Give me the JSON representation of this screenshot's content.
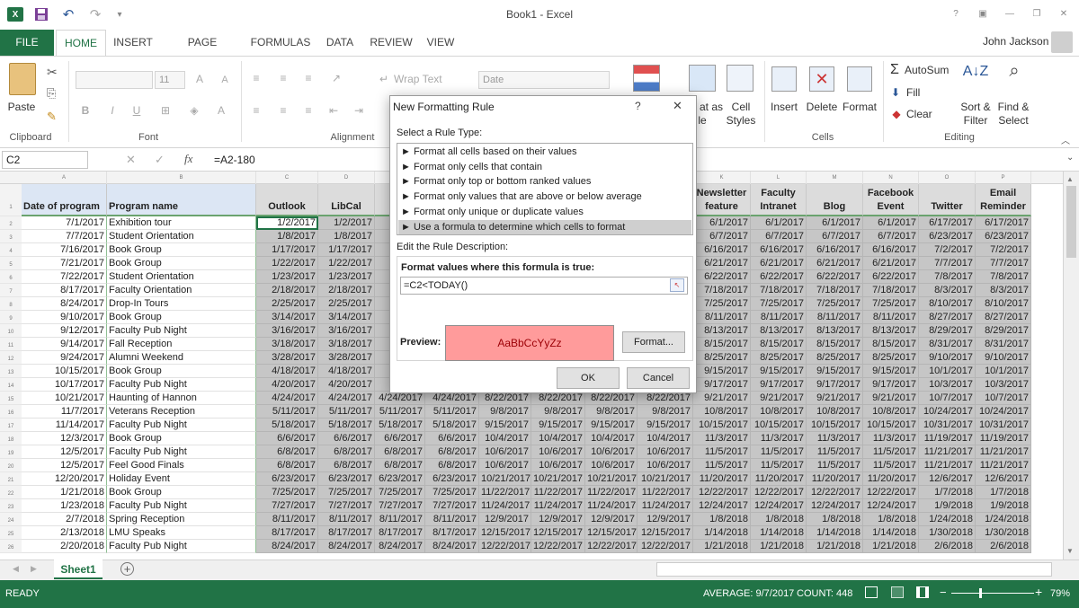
{
  "title": "Book1 - Excel",
  "user": "John Jackson",
  "tabs": [
    "FILE",
    "HOME",
    "INSERT",
    "PAGE LAYOUT",
    "FORMULAS",
    "DATA",
    "REVIEW",
    "VIEW"
  ],
  "ribbon": {
    "paste": "Paste",
    "clipboard": "Clipboard",
    "font_group": "Font",
    "font_size": "11",
    "alignment": "Alignment",
    "wrap_text": "Wrap Text",
    "number_format": "Date",
    "format_as": "at as",
    "format_as2": "le",
    "cell_styles": "Cell",
    "cell_styles2": "Styles",
    "insert": "Insert",
    "delete": "Delete",
    "format": "Format",
    "cells_group": "Cells",
    "autosum": "AutoSum",
    "fill": "Fill",
    "clear": "Clear",
    "sort_filter": "Sort &",
    "sort_filter2": "Filter",
    "find_select": "Find &",
    "find_select2": "Select",
    "editing_group": "Editing"
  },
  "namebox": "C2",
  "formula": "=A2-180",
  "columns": [
    "A",
    "B",
    "C",
    "D",
    "E",
    "F",
    "G",
    "H",
    "I",
    "J",
    "K",
    "L",
    "M",
    "N",
    "O",
    "P"
  ],
  "headers": {
    "a": "Date of program",
    "b": "Program name",
    "c": "Outlook",
    "d": "LibCal",
    "e": "L",
    "k1": "Newsletter",
    "k2": "feature",
    "l1": "Faculty",
    "l2": "Intranet",
    "m": "Blog",
    "n1": "Facebook",
    "n2": "Event",
    "o": "Twitter",
    "p1": "Email",
    "p2": "Reminder"
  },
  "rows": [
    [
      "7/1/2017",
      "Exhibition tour",
      "1/2/2017",
      "1/2/2017",
      "",
      "",
      "",
      "",
      "",
      "",
      "6/1/2017",
      "6/1/2017",
      "6/1/2017",
      "6/1/2017",
      "6/17/2017",
      "6/17/2017"
    ],
    [
      "7/7/2017",
      "Student Orientation",
      "1/8/2017",
      "1/8/2017",
      "",
      "",
      "",
      "",
      "",
      "",
      "6/7/2017",
      "6/7/2017",
      "6/7/2017",
      "6/7/2017",
      "6/23/2017",
      "6/23/2017"
    ],
    [
      "7/16/2017",
      "Book Group",
      "1/17/2017",
      "1/17/2017",
      "",
      "",
      "",
      "",
      "",
      "",
      "6/16/2017",
      "6/16/2017",
      "6/16/2017",
      "6/16/2017",
      "7/2/2017",
      "7/2/2017"
    ],
    [
      "7/21/2017",
      "Book Group",
      "1/22/2017",
      "1/22/2017",
      "",
      "",
      "",
      "",
      "",
      "",
      "6/21/2017",
      "6/21/2017",
      "6/21/2017",
      "6/21/2017",
      "7/7/2017",
      "7/7/2017"
    ],
    [
      "7/22/2017",
      "Student Orientation",
      "1/23/2017",
      "1/23/2017",
      "",
      "",
      "",
      "",
      "",
      "",
      "6/22/2017",
      "6/22/2017",
      "6/22/2017",
      "6/22/2017",
      "7/8/2017",
      "7/8/2017"
    ],
    [
      "8/17/2017",
      "Faculty Orientation",
      "2/18/2017",
      "2/18/2017",
      "",
      "",
      "",
      "",
      "",
      "",
      "7/18/2017",
      "7/18/2017",
      "7/18/2017",
      "7/18/2017",
      "8/3/2017",
      "8/3/2017"
    ],
    [
      "8/24/2017",
      "Drop-In Tours",
      "2/25/2017",
      "2/25/2017",
      "",
      "",
      "",
      "",
      "",
      "",
      "7/25/2017",
      "7/25/2017",
      "7/25/2017",
      "7/25/2017",
      "8/10/2017",
      "8/10/2017"
    ],
    [
      "9/10/2017",
      "Book Group",
      "3/14/2017",
      "3/14/2017",
      "",
      "",
      "",
      "",
      "",
      "",
      "8/11/2017",
      "8/11/2017",
      "8/11/2017",
      "8/11/2017",
      "8/27/2017",
      "8/27/2017"
    ],
    [
      "9/12/2017",
      "Faculty Pub Night",
      "3/16/2017",
      "3/16/2017",
      "",
      "",
      "",
      "",
      "",
      "",
      "8/13/2017",
      "8/13/2017",
      "8/13/2017",
      "8/13/2017",
      "8/29/2017",
      "8/29/2017"
    ],
    [
      "9/14/2017",
      "Fall Reception",
      "3/18/2017",
      "3/18/2017",
      "",
      "",
      "",
      "",
      "",
      "",
      "8/15/2017",
      "8/15/2017",
      "8/15/2017",
      "8/15/2017",
      "8/31/2017",
      "8/31/2017"
    ],
    [
      "9/24/2017",
      "Alumni Weekend",
      "3/28/2017",
      "3/28/2017",
      "",
      "",
      "",
      "",
      "",
      "",
      "8/25/2017",
      "8/25/2017",
      "8/25/2017",
      "8/25/2017",
      "9/10/2017",
      "9/10/2017"
    ],
    [
      "10/15/2017",
      "Book Group",
      "4/18/2017",
      "4/18/2017",
      "",
      "",
      "",
      "",
      "",
      "",
      "9/15/2017",
      "9/15/2017",
      "9/15/2017",
      "9/15/2017",
      "10/1/2017",
      "10/1/2017"
    ],
    [
      "10/17/2017",
      "Faculty Pub Night",
      "4/20/2017",
      "4/20/2017",
      "",
      "",
      "",
      "",
      "",
      "",
      "9/17/2017",
      "9/17/2017",
      "9/17/2017",
      "9/17/2017",
      "10/3/2017",
      "10/3/2017"
    ],
    [
      "10/21/2017",
      "Haunting of Hannon",
      "4/24/2017",
      "4/24/2017",
      "4/24/2017",
      "4/24/2017",
      "8/22/2017",
      "8/22/2017",
      "8/22/2017",
      "8/22/2017",
      "9/21/2017",
      "9/21/2017",
      "9/21/2017",
      "9/21/2017",
      "10/7/2017",
      "10/7/2017"
    ],
    [
      "11/7/2017",
      "Veterans Reception",
      "5/11/2017",
      "5/11/2017",
      "5/11/2017",
      "5/11/2017",
      "9/8/2017",
      "9/8/2017",
      "9/8/2017",
      "9/8/2017",
      "10/8/2017",
      "10/8/2017",
      "10/8/2017",
      "10/8/2017",
      "10/24/2017",
      "10/24/2017"
    ],
    [
      "11/14/2017",
      "Faculty Pub Night",
      "5/18/2017",
      "5/18/2017",
      "5/18/2017",
      "5/18/2017",
      "9/15/2017",
      "9/15/2017",
      "9/15/2017",
      "9/15/2017",
      "10/15/2017",
      "10/15/2017",
      "10/15/2017",
      "10/15/2017",
      "10/31/2017",
      "10/31/2017"
    ],
    [
      "12/3/2017",
      "Book Group",
      "6/6/2017",
      "6/6/2017",
      "6/6/2017",
      "6/6/2017",
      "10/4/2017",
      "10/4/2017",
      "10/4/2017",
      "10/4/2017",
      "11/3/2017",
      "11/3/2017",
      "11/3/2017",
      "11/3/2017",
      "11/19/2017",
      "11/19/2017"
    ],
    [
      "12/5/2017",
      "Faculty Pub Night",
      "6/8/2017",
      "6/8/2017",
      "6/8/2017",
      "6/8/2017",
      "10/6/2017",
      "10/6/2017",
      "10/6/2017",
      "10/6/2017",
      "11/5/2017",
      "11/5/2017",
      "11/5/2017",
      "11/5/2017",
      "11/21/2017",
      "11/21/2017"
    ],
    [
      "12/5/2017",
      "Feel Good Finals",
      "6/8/2017",
      "6/8/2017",
      "6/8/2017",
      "6/8/2017",
      "10/6/2017",
      "10/6/2017",
      "10/6/2017",
      "10/6/2017",
      "11/5/2017",
      "11/5/2017",
      "11/5/2017",
      "11/5/2017",
      "11/21/2017",
      "11/21/2017"
    ],
    [
      "12/20/2017",
      "Holiday Event",
      "6/23/2017",
      "6/23/2017",
      "6/23/2017",
      "6/23/2017",
      "10/21/2017",
      "10/21/2017",
      "10/21/2017",
      "10/21/2017",
      "11/20/2017",
      "11/20/2017",
      "11/20/2017",
      "11/20/2017",
      "12/6/2017",
      "12/6/2017"
    ],
    [
      "1/21/2018",
      "Book Group",
      "7/25/2017",
      "7/25/2017",
      "7/25/2017",
      "7/25/2017",
      "11/22/2017",
      "11/22/2017",
      "11/22/2017",
      "11/22/2017",
      "12/22/2017",
      "12/22/2017",
      "12/22/2017",
      "12/22/2017",
      "1/7/2018",
      "1/7/2018"
    ],
    [
      "1/23/2018",
      "Faculty Pub Night",
      "7/27/2017",
      "7/27/2017",
      "7/27/2017",
      "7/27/2017",
      "11/24/2017",
      "11/24/2017",
      "11/24/2017",
      "11/24/2017",
      "12/24/2017",
      "12/24/2017",
      "12/24/2017",
      "12/24/2017",
      "1/9/2018",
      "1/9/2018"
    ],
    [
      "2/7/2018",
      "Spring Reception",
      "8/11/2017",
      "8/11/2017",
      "8/11/2017",
      "8/11/2017",
      "12/9/2017",
      "12/9/2017",
      "12/9/2017",
      "12/9/2017",
      "1/8/2018",
      "1/8/2018",
      "1/8/2018",
      "1/8/2018",
      "1/24/2018",
      "1/24/2018"
    ],
    [
      "2/13/2018",
      "LMU Speaks",
      "8/17/2017",
      "8/17/2017",
      "8/17/2017",
      "8/17/2017",
      "12/15/2017",
      "12/15/2017",
      "12/15/2017",
      "12/15/2017",
      "1/14/2018",
      "1/14/2018",
      "1/14/2018",
      "1/14/2018",
      "1/30/2018",
      "1/30/2018"
    ],
    [
      "2/20/2018",
      "Faculty Pub Night",
      "8/24/2017",
      "8/24/2017",
      "8/24/2017",
      "8/24/2017",
      "12/22/2017",
      "12/22/2017",
      "12/22/2017",
      "12/22/2017",
      "1/21/2018",
      "1/21/2018",
      "1/21/2018",
      "1/21/2018",
      "2/6/2018",
      "2/6/2018"
    ]
  ],
  "sheet_tab": "Sheet1",
  "status": {
    "ready": "READY",
    "average": "AVERAGE: 9/7/2017",
    "count": "COUNT: 448",
    "zoom": "79%"
  },
  "dialog": {
    "title": "New Formatting Rule",
    "help": "?",
    "close": "✕",
    "select_label": "Select a Rule Type:",
    "rule_types": [
      "► Format all cells based on their values",
      "► Format only cells that contain",
      "► Format only top or bottom ranked values",
      "► Format only values that are above or below average",
      "► Format only unique or duplicate values",
      "► Use a formula to determine which cells to format"
    ],
    "edit_label": "Edit the Rule Description:",
    "formula_label": "Format values where this formula is true:",
    "formula_value": "=C2<TODAY()",
    "preview_label": "Preview:",
    "preview_text": "AaBbCcYyZz",
    "format_button": "Format...",
    "ok": "OK",
    "cancel": "Cancel"
  },
  "colors": {
    "excel_green": "#217346",
    "preview_fill": "#ff9b9b",
    "selection": "#c6c6c6"
  }
}
